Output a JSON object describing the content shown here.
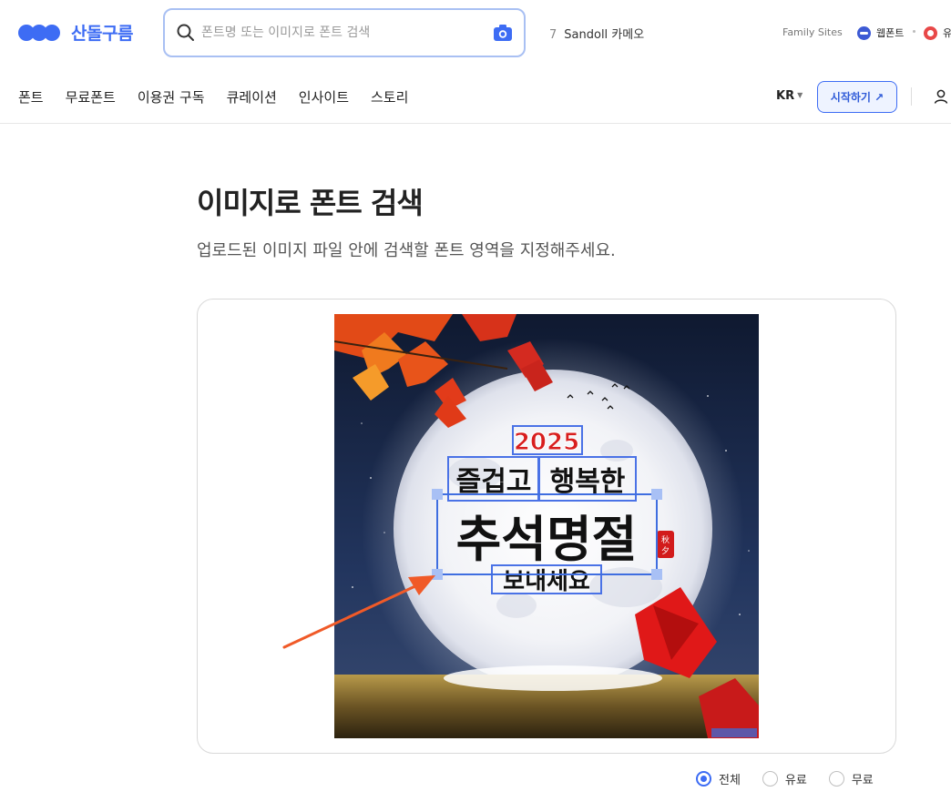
{
  "header": {
    "brand": "산돌구름",
    "search": {
      "placeholder": "폰트명 또는 이미지로 폰트 검색"
    },
    "trending": {
      "rank": "7",
      "keyword": "Sandoll 카메오"
    },
    "family_sites_label": "Family Sites",
    "site_webfont": "웹폰트",
    "site_other": "유"
  },
  "nav": {
    "items": [
      "폰트",
      "무료폰트",
      "이용권 구독",
      "큐레이션",
      "인사이트",
      "스토리"
    ],
    "lang": "KR",
    "start_label": "시작하기 ↗"
  },
  "main": {
    "title": "이미지로 폰트 검색",
    "subtitle": "업로드된 이미지 파일 안에 검색할 폰트 영역을 지정해주세요."
  },
  "image": {
    "texts": [
      "2025",
      "즐겁고",
      "행복한",
      "추석명절",
      "보내세요",
      "秋",
      "夕"
    ]
  },
  "filters": {
    "options": [
      "전체",
      "유료",
      "무료"
    ],
    "selected": "전체"
  },
  "colors": {
    "accent": "#3d6cf4",
    "selection": "#3f6ee0"
  }
}
